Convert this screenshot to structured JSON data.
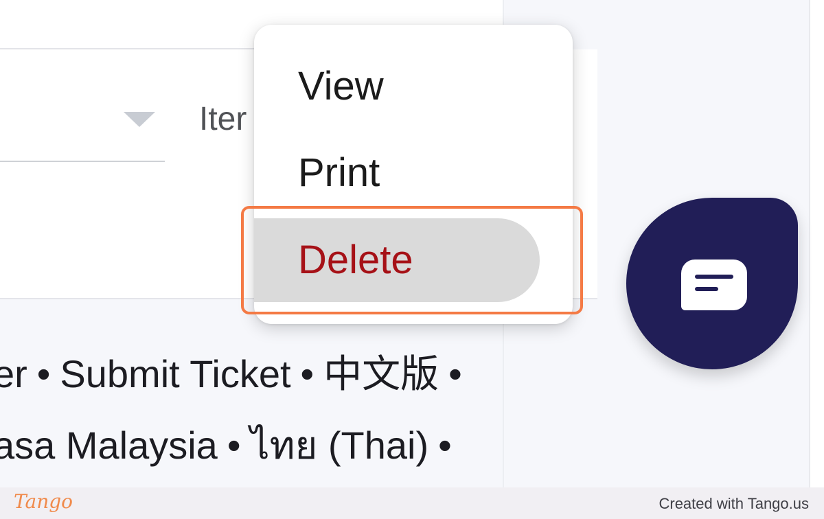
{
  "form": {
    "items_label": "Iter"
  },
  "context_menu": {
    "items": [
      {
        "label": "View"
      },
      {
        "label": "Print"
      },
      {
        "label": "Delete"
      }
    ],
    "highlighted": "Delete"
  },
  "footer": {
    "line1": {
      "partial_link": "er",
      "submit_ticket": "Submit Ticket",
      "chinese": "中文版"
    },
    "line2": {
      "malay": "asa Malaysia",
      "thai": "ไทย (Thai)"
    },
    "separator": "•"
  },
  "chat": {
    "icon": "chat-bubble-icon"
  },
  "watermark": {
    "logo": "Tango",
    "credit": "Created with Tango.us"
  },
  "colors": {
    "delete_text": "#a61117",
    "highlight_border": "#f47a45",
    "chat_fab": "#211e57",
    "tango_orange": "#f08a4b"
  }
}
